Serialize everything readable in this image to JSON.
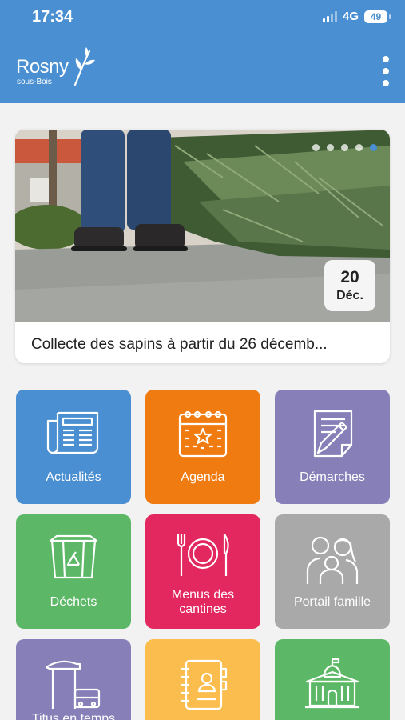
{
  "status_bar": {
    "time": "17:34",
    "network": "4G",
    "battery": "49"
  },
  "header": {
    "logo_main": "Rosny",
    "logo_sub": "sous-Bois",
    "menu_icon": "more-vertical-icon",
    "background": "#4a8fd1"
  },
  "news": {
    "title": "Collecte des sapins à partir du 26 décemb...",
    "date_day": "20",
    "date_month": "Déc.",
    "carousel_dots": 5,
    "active_dot": 5
  },
  "tiles": [
    {
      "label": "Actualités",
      "icon": "newspaper-icon",
      "color": "#4a8fd1"
    },
    {
      "label": "Agenda",
      "icon": "calendar-icon",
      "color": "#f07b11"
    },
    {
      "label": "Démarches",
      "icon": "form-edit-icon",
      "color": "#8780b8"
    },
    {
      "label": "Déchets",
      "icon": "recycle-bin-icon",
      "color": "#5cb866"
    },
    {
      "label": "Menus des cantines",
      "icon": "plate-cutlery-icon",
      "color": "#e2285e"
    },
    {
      "label": "Portail famille",
      "icon": "family-icon",
      "color": "#a9a9a9"
    },
    {
      "label": "Titus en temps",
      "icon": "bus-stop-icon",
      "color": "#8780b8"
    },
    {
      "label": "",
      "icon": "address-book-icon",
      "color": "#fbbd4e"
    },
    {
      "label": "",
      "icon": "town-hall-icon",
      "color": "#5cb866"
    }
  ]
}
